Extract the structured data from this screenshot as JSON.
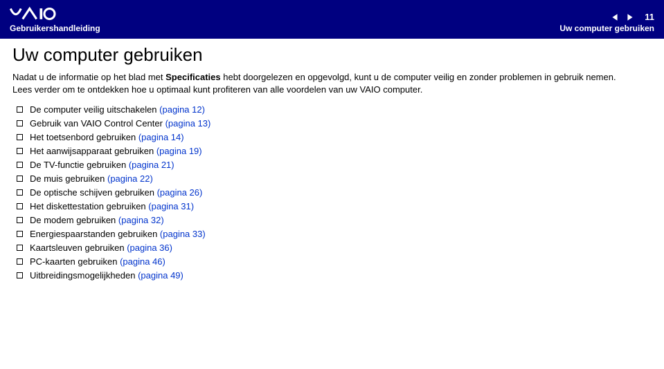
{
  "header": {
    "guide_label": "Gebruikershandleiding",
    "page_number": "11",
    "section_label": "Uw computer gebruiken"
  },
  "page_title": "Uw computer gebruiken",
  "intro": {
    "part1": "Nadat u de informatie op het blad met ",
    "bold": "Specificaties",
    "part2": " hebt doorgelezen en opgevolgd, kunt u de computer veilig en zonder problemen in gebruik nemen. Lees verder om te ontdekken hoe u optimaal kunt profiteren van alle voordelen van uw VAIO computer."
  },
  "toc": [
    {
      "text": "De computer veilig uitschakelen ",
      "link": "(pagina 12)"
    },
    {
      "text": "Gebruik van VAIO Control Center ",
      "link": "(pagina 13)"
    },
    {
      "text": "Het toetsenbord gebruiken ",
      "link": "(pagina 14)"
    },
    {
      "text": "Het aanwijsapparaat gebruiken ",
      "link": "(pagina 19)"
    },
    {
      "text": "De TV-functie gebruiken ",
      "link": "(pagina 21)"
    },
    {
      "text": "De muis gebruiken ",
      "link": "(pagina 22)"
    },
    {
      "text": "De optische schijven gebruiken ",
      "link": "(pagina 26)"
    },
    {
      "text": "Het diskettestation gebruiken ",
      "link": "(pagina 31)"
    },
    {
      "text": "De modem gebruiken ",
      "link": "(pagina 32)"
    },
    {
      "text": "Energiespaarstanden gebruiken ",
      "link": "(pagina 33)"
    },
    {
      "text": "Kaartsleuven gebruiken ",
      "link": "(pagina 36)"
    },
    {
      "text": "PC-kaarten gebruiken ",
      "link": "(pagina 46)"
    },
    {
      "text": "Uitbreidingsmogelijkheden ",
      "link": "(pagina 49)"
    }
  ]
}
